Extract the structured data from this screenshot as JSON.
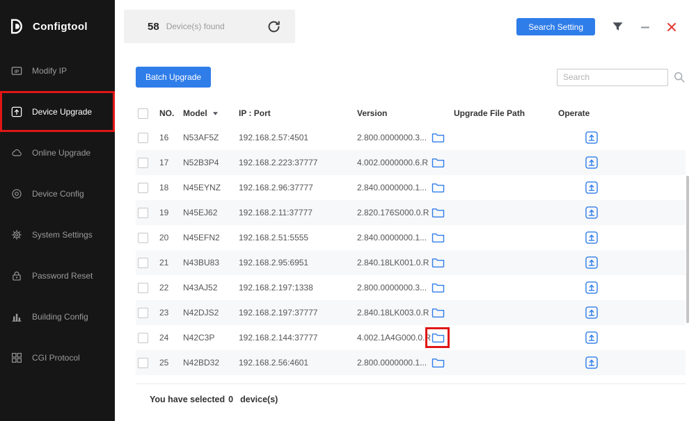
{
  "app": {
    "brand": "Configtool"
  },
  "sidebar": {
    "items": [
      {
        "label": "Modify IP",
        "icon": "modify-ip-icon",
        "active": false,
        "highlighted": false
      },
      {
        "label": "Device Upgrade",
        "icon": "device-upgrade-icon",
        "active": true,
        "highlighted": true
      },
      {
        "label": "Online Upgrade",
        "icon": "online-upgrade-icon",
        "active": false,
        "highlighted": false
      },
      {
        "label": "Device Config",
        "icon": "device-config-icon",
        "active": false,
        "highlighted": false
      },
      {
        "label": "System Settings",
        "icon": "system-settings-icon",
        "active": false,
        "highlighted": false
      },
      {
        "label": "Password Reset",
        "icon": "password-reset-icon",
        "active": false,
        "highlighted": false
      },
      {
        "label": "Building Config",
        "icon": "building-config-icon",
        "active": false,
        "highlighted": false
      },
      {
        "label": "CGI Protocol",
        "icon": "cgi-protocol-icon",
        "active": false,
        "highlighted": false
      }
    ]
  },
  "header": {
    "device_count": "58",
    "device_count_label": "Device(s) found",
    "search_setting_button": "Search Setting"
  },
  "toolbar": {
    "batch_upgrade_button": "Batch Upgrade",
    "search_placeholder": "Search"
  },
  "table": {
    "columns": {
      "no": "NO.",
      "model": "Model",
      "ip_port": "IP : Port",
      "version": "Version",
      "upgrade_file_path": "Upgrade File Path",
      "operate": "Operate"
    },
    "rows": [
      {
        "no": "16",
        "model": "N53AF5Z",
        "ip_port": "192.168.2.57:4501",
        "version": "2.800.0000000.3...",
        "highlighted": false
      },
      {
        "no": "17",
        "model": "N52B3P4",
        "ip_port": "192.168.2.223:37777",
        "version": "4.002.0000000.6.R",
        "highlighted": false
      },
      {
        "no": "18",
        "model": "N45EYNZ",
        "ip_port": "192.168.2.96:37777",
        "version": "2.840.0000000.1...",
        "highlighted": false
      },
      {
        "no": "19",
        "model": "N45EJ62",
        "ip_port": "192.168.2.11:37777",
        "version": "2.820.176S000.0.R",
        "highlighted": false
      },
      {
        "no": "20",
        "model": "N45EFN2",
        "ip_port": "192.168.2.51:5555",
        "version": "2.840.0000000.1...",
        "highlighted": false
      },
      {
        "no": "21",
        "model": "N43BU83",
        "ip_port": "192.168.2.95:6951",
        "version": "2.840.18LK001.0.R",
        "highlighted": false
      },
      {
        "no": "22",
        "model": "N43AJ52",
        "ip_port": "192.168.2.197:1338",
        "version": "2.800.0000000.3...",
        "highlighted": false
      },
      {
        "no": "23",
        "model": "N42DJS2",
        "ip_port": "192.168.2.197:37777",
        "version": "2.840.18LK003.0.R",
        "highlighted": false
      },
      {
        "no": "24",
        "model": "N42C3P",
        "ip_port": "192.168.2.144:37777",
        "version": "4.002.1A4G000.0.R",
        "highlighted": true
      },
      {
        "no": "25",
        "model": "N42BD32",
        "ip_port": "192.168.2.56:4601",
        "version": "2.800.0000000.1...",
        "highlighted": false
      }
    ]
  },
  "footer": {
    "selected_text": "You have selected",
    "selected_count": "0",
    "selected_unit": "device(s)"
  },
  "colors": {
    "accent_blue": "#2f7de9",
    "highlight_red": "#e01616",
    "sidebar_bg": "#161616"
  }
}
